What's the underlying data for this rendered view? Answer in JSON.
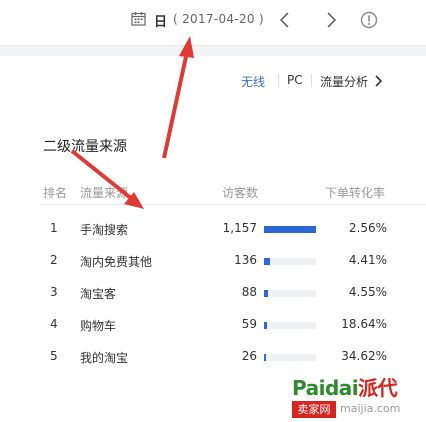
{
  "header": {
    "date_label": "日",
    "date_value": "( 2017-04-20 )"
  },
  "subnav": {
    "items": [
      "无线",
      "PC",
      "流量分析"
    ]
  },
  "section": {
    "title": "二级流量来源"
  },
  "table": {
    "columns": [
      "排名",
      "流量来源",
      "访客数",
      "下单转化率"
    ],
    "rows": [
      {
        "rank": "1",
        "source": "手淘搜索",
        "visitors": "1,157",
        "visitors_value": 1157,
        "rate": "2.56%"
      },
      {
        "rank": "2",
        "source": "淘内免费其他",
        "visitors": "136",
        "visitors_value": 136,
        "rate": "4.41%"
      },
      {
        "rank": "3",
        "source": "淘宝客",
        "visitors": "88",
        "visitors_value": 88,
        "rate": "4.55%"
      },
      {
        "rank": "4",
        "source": "购物车",
        "visitors": "59",
        "visitors_value": 59,
        "rate": "18.64%"
      },
      {
        "rank": "5",
        "source": "我的淘宝",
        "visitors": "26",
        "visitors_value": 26,
        "rate": "34.62%"
      }
    ]
  },
  "watermark": {
    "brand_green": "Paidai",
    "brand_red": "派代",
    "badge": "卖家网",
    "url": "maijia.com"
  },
  "colors": {
    "accent": "#2e68d5",
    "annotation_arrow": "#e03a35"
  }
}
